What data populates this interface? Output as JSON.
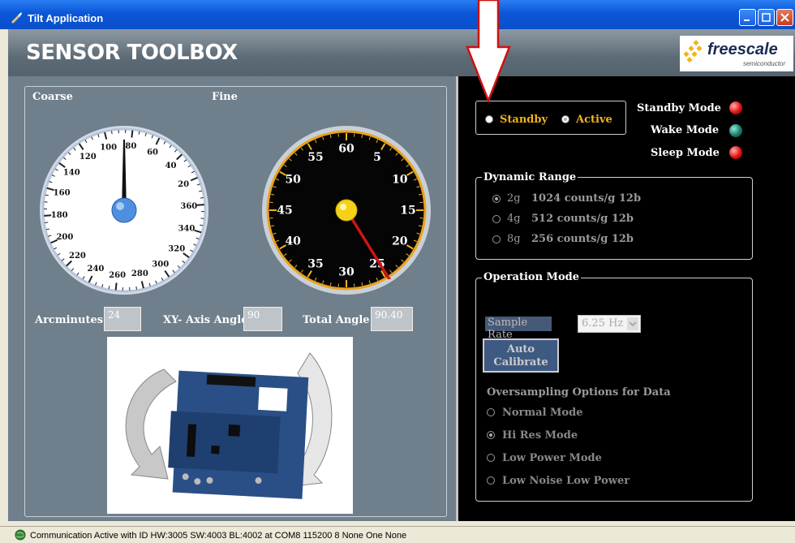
{
  "window": {
    "title": "Tilt Application"
  },
  "header": {
    "title": "SENSOR TOOLBOX",
    "logo_text": "freescale",
    "logo_sub": "semiconductor"
  },
  "gauges": {
    "coarse_label": "Coarse",
    "fine_label": "Fine",
    "coarse_ticks": [
      "100",
      "80",
      "60",
      "40",
      "20",
      "360",
      "340",
      "320",
      "300",
      "280",
      "260",
      "240",
      "220",
      "200",
      "180",
      "160",
      "140",
      "120"
    ],
    "fine_ticks": [
      "60",
      "5",
      "10",
      "15",
      "20",
      "25",
      "30",
      "35",
      "40",
      "45",
      "50",
      "55"
    ]
  },
  "readouts": {
    "arcminutes_label": "Arcminutes",
    "arcminutes_value": "24",
    "xy_label": "XY- Axis Angle",
    "xy_value": "90",
    "total_label": "Total Angle",
    "total_value": "90.40"
  },
  "mode": {
    "standby": "Standby",
    "active": "Active",
    "selected": "Active"
  },
  "status_leds": [
    {
      "label": "Standby Mode",
      "color": "#e01010"
    },
    {
      "label": "Wake Mode",
      "color": "#1a7a6a"
    },
    {
      "label": "Sleep Mode",
      "color": "#e01010"
    }
  ],
  "dynamic_range": {
    "title": "Dynamic Range",
    "options": [
      {
        "g": "2g",
        "desc": "1024 counts/g 12b",
        "selected": true
      },
      {
        "g": "4g",
        "desc": "512 counts/g 12b",
        "selected": false
      },
      {
        "g": "8g",
        "desc": "256 counts/g 12b",
        "selected": false
      }
    ]
  },
  "operation": {
    "title": "Operation Mode",
    "sample_rate_label": "Sample Rate",
    "sample_rate_value": "6.25 Hz",
    "calibrate_line1": "Auto",
    "calibrate_line2": "Calibrate",
    "oversampling_title": "Oversampling Options for Data",
    "options": [
      "Normal Mode",
      "Hi Res Mode",
      "Low Power Mode",
      "Low Noise Low Power"
    ],
    "selected": "Hi Res Mode"
  },
  "status": {
    "text": "Communication Active with ID HW:3005 SW:4003 BL:4002 at COM8 115200 8 None One None"
  },
  "colors": {
    "accent": "#f2b31b",
    "panel": "#6f7f8c",
    "led_red": "#e01010",
    "led_green": "#1a7a6a"
  }
}
